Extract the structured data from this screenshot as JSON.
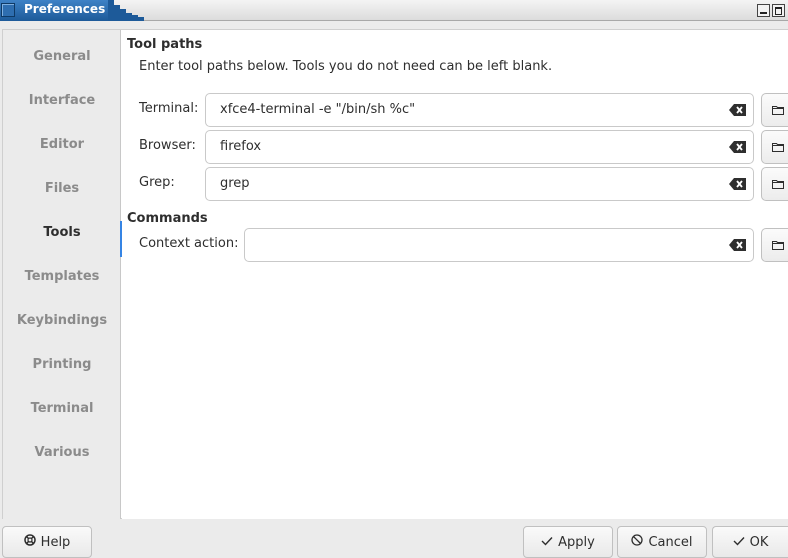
{
  "window": {
    "title": "Preferences"
  },
  "sidebar": {
    "items": [
      {
        "label": "General"
      },
      {
        "label": "Interface"
      },
      {
        "label": "Editor"
      },
      {
        "label": "Files"
      },
      {
        "label": "Tools",
        "active": true
      },
      {
        "label": "Templates"
      },
      {
        "label": "Keybindings"
      },
      {
        "label": "Printing"
      },
      {
        "label": "Terminal"
      },
      {
        "label": "Various"
      }
    ]
  },
  "tool_paths": {
    "title": "Tool paths",
    "description": "Enter tool paths below. Tools you do not need can be left blank.",
    "terminal": {
      "label": "Terminal:",
      "value": "xfce4-terminal -e \"/bin/sh %c\""
    },
    "browser": {
      "label": "Browser:",
      "value": "firefox"
    },
    "grep": {
      "label": "Grep:",
      "value": "grep"
    }
  },
  "commands": {
    "title": "Commands",
    "context_action": {
      "label": "Context action:",
      "value": ""
    }
  },
  "buttons": {
    "help": "Help",
    "apply": "Apply",
    "cancel": "Cancel",
    "ok": "OK"
  },
  "colors": {
    "accent": "#3584e4",
    "titlebar_active": "#1d5a99"
  },
  "icons": {
    "window": "window-icon",
    "clear": "edit-clear-icon",
    "browse": "folder-icon",
    "help": "help-lifebuoy-icon",
    "apply": "checkmark-icon",
    "cancel": "cancel-circle-icon",
    "ok": "checkmark-icon"
  }
}
